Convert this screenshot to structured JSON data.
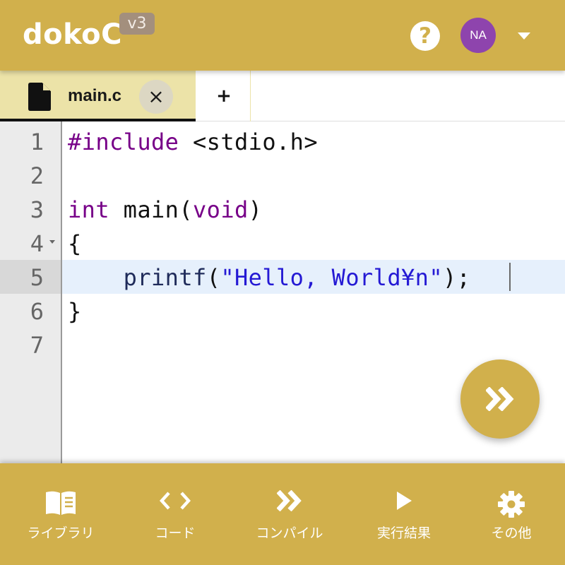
{
  "header": {
    "logo": "dokoC",
    "version": "v3",
    "help_icon": "?",
    "avatar_initials": "NA"
  },
  "tabs": {
    "active": {
      "label": "main.c",
      "close": "×"
    },
    "add": "+"
  },
  "editor": {
    "line_numbers": [
      "1",
      "2",
      "3",
      "4",
      "5",
      "6",
      "7"
    ],
    "active_line": 5,
    "code": {
      "l1_kw": "#include",
      "l1_rest": " <stdio.h>",
      "l3_kw1": "int",
      "l3_mid": " main(",
      "l3_kw2": "void",
      "l3_end": ")",
      "l4": "{",
      "l5_indent": "    ",
      "l5_fn": "printf",
      "l5_open": "(",
      "l5_str": "\"Hello, World¥n\"",
      "l5_close": ");",
      "l6": "}"
    }
  },
  "bottom_nav": {
    "items": [
      {
        "label": "ライブラリ",
        "icon": "book-icon"
      },
      {
        "label": "コード",
        "icon": "code-icon"
      },
      {
        "label": "コンパイル",
        "icon": "compile-icon"
      },
      {
        "label": "実行結果",
        "icon": "play-icon"
      },
      {
        "label": "その他",
        "icon": "gear-icon"
      }
    ]
  },
  "colors": {
    "primary": "#d1b04c",
    "active_tab": "#ece3a8",
    "avatar": "#8e44ad",
    "keyword": "#770088",
    "string": "#2419d4",
    "active_line": "#e6f0fc"
  }
}
